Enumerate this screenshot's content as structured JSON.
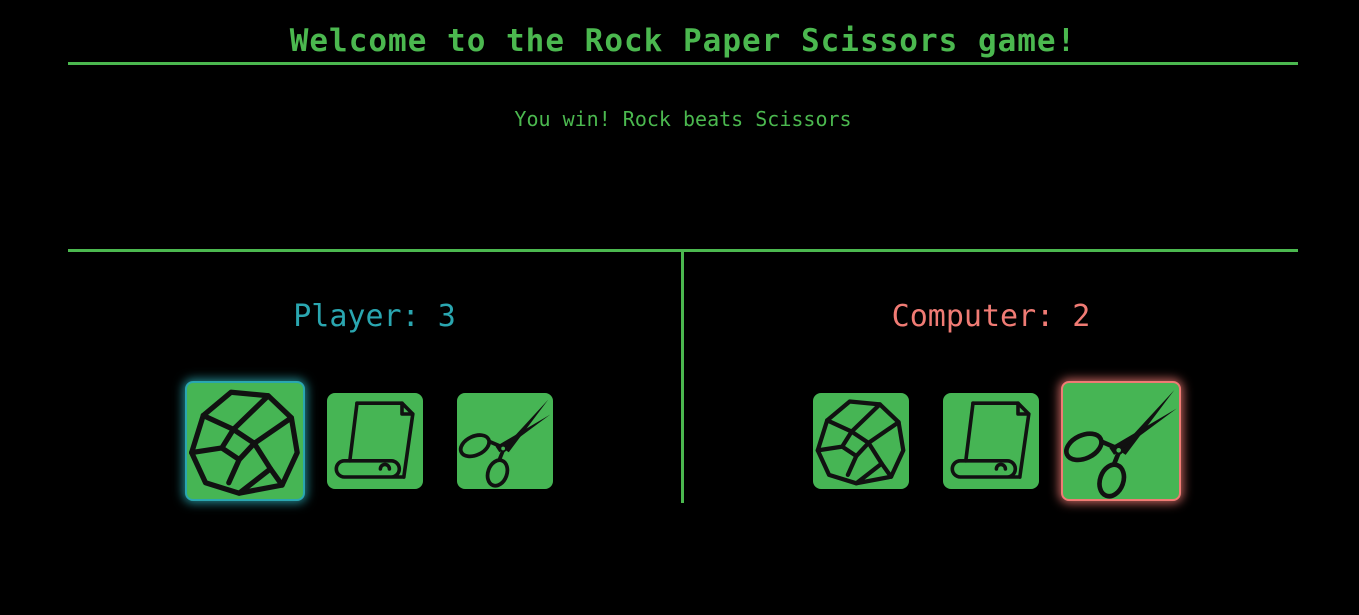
{
  "title": "Welcome to the Rock Paper Scissors game!",
  "result": "You win! Rock beats Scissors",
  "player": {
    "label": "Player: 3",
    "score": 3,
    "selected": "rock",
    "choices": [
      "rock-icon",
      "paper-icon",
      "scissors-icon"
    ]
  },
  "computer": {
    "label": "Computer: 2",
    "score": 2,
    "selected": "scissors",
    "choices": [
      "rock-icon",
      "paper-icon",
      "scissors-icon"
    ]
  },
  "colors": {
    "accent": "#4bb84f",
    "tile": "#46b554",
    "player": "#2aa6b0",
    "computer": "#f07b74",
    "background": "#000000"
  }
}
